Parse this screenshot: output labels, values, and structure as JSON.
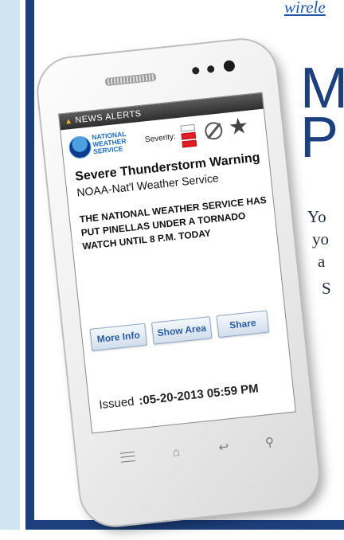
{
  "page": {
    "top_link": "wirele",
    "title_line1": "M",
    "title_line2": "P",
    "body_fragments": [
      "Yo",
      "yo",
      "a",
      "S"
    ]
  },
  "phone": {
    "alert_bar": {
      "icon": "warning-triangle-icon",
      "label": "NEWS ALERTS"
    },
    "header": {
      "logo_text": "NATIONAL WEATHER SERVICE",
      "severity_label": "Severity:",
      "severity_level": "2 of 3",
      "icons": [
        "no-symbol-icon",
        "star-icon"
      ]
    },
    "alert": {
      "title": "Severe Thunderstorm Warning",
      "source": "NOAA-Nat'l Weather Service",
      "body": "THE NATIONAL WEATHER SERVICE HAS PUT PINELLAS UNDER A TORNADO WATCH UNTIL 8 P.M. TODAY"
    },
    "buttons": {
      "more_info": "More Info",
      "show_area": "Show Area",
      "share": "Share"
    },
    "issued": {
      "label": "Issued",
      "value": ":05-20-2013 05:59 PM"
    },
    "nav_icons": [
      "menu-icon",
      "home-icon",
      "back-icon",
      "search-icon"
    ],
    "colors": {
      "severity_red": "#e01e27",
      "frame_blue": "#1d3f7c",
      "button_text": "#2a5d9c"
    }
  }
}
